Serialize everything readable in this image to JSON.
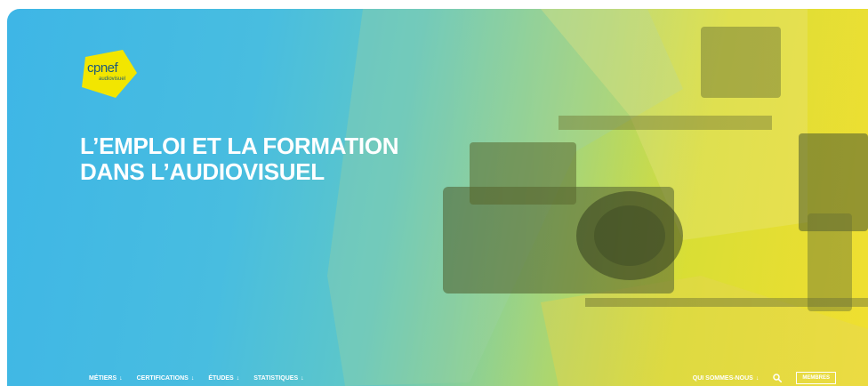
{
  "brand": {
    "name": "cpnef",
    "sub": "audiovisuel",
    "logo_color": "#f2e600"
  },
  "hero": {
    "title_line1": "L’EMPLOI ET LA FORMATION",
    "title_line2": "DANS L’AUDIOVISUEL"
  },
  "nav": {
    "left": [
      {
        "label": "MÉTIERS",
        "arrow": "↓"
      },
      {
        "label": "CERTIFICATIONS",
        "arrow": "↓"
      },
      {
        "label": "ÉTUDES",
        "arrow": "↓"
      },
      {
        "label": "STATISTIQUES",
        "arrow": "↓"
      }
    ],
    "right": {
      "about": {
        "label": "QUI SOMMES-NOUS",
        "arrow": "↓"
      },
      "members": "MEMBRES"
    }
  },
  "icons": {
    "search": "search-icon"
  },
  "colors": {
    "blue": "#3eb6e6",
    "yellow": "#f0dc1e",
    "white": "#ffffff"
  }
}
